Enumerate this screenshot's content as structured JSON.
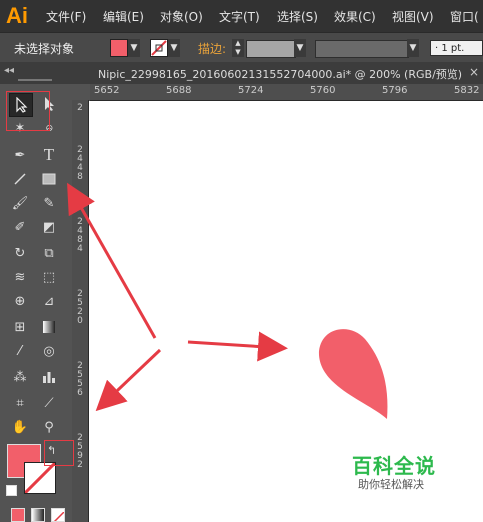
{
  "app": {
    "logo": "Ai"
  },
  "menu": [
    "文件(F)",
    "编辑(E)",
    "对象(O)",
    "文字(T)",
    "选择(S)",
    "效果(C)",
    "视图(V)",
    "窗口("
  ],
  "control_bar": {
    "selection_label": "未选择对象",
    "stroke_label": "描边:",
    "stroke_weight": "1 pt.",
    "fill_color": "#f25f6a"
  },
  "document_tab": {
    "title": "Nipic_22998165_20160602131552704000.ai* @ 200% (RGB/预览)",
    "close": "×"
  },
  "rulers": {
    "horizontal": [
      "5652",
      "5688",
      "5724",
      "5760",
      "5796",
      "5832"
    ],
    "vertical": [
      "2",
      "2\n4\n4\n8",
      "2\n4\n8\n4",
      "2\n5\n2\n0",
      "2\n5\n5\n6",
      "2\n5\n9\n2"
    ]
  },
  "tools": [
    "selection-tool",
    "direct-selection-tool",
    "magic-wand-tool",
    "lasso-tool",
    "pen-tool",
    "type-tool",
    "line-tool",
    "rectangle-tool",
    "paintbrush-tool",
    "pencil-tool",
    "blob-brush-tool",
    "eraser-tool",
    "rotate-tool",
    "scale-tool",
    "width-tool",
    "free-transform-tool",
    "shape-builder-tool",
    "perspective-grid-tool",
    "mesh-tool",
    "gradient-tool",
    "eyedropper-tool",
    "blend-tool",
    "symbol-sprayer-tool",
    "column-graph-tool",
    "artboard-tool",
    "slice-tool",
    "hand-tool",
    "zoom-tool"
  ],
  "colors": {
    "accent_red": "#e53b44",
    "droplet": "#f25f6a",
    "watermark_green": "#2db94d"
  },
  "watermark": {
    "title": "百科全说",
    "subtitle": "助你轻松解决"
  }
}
